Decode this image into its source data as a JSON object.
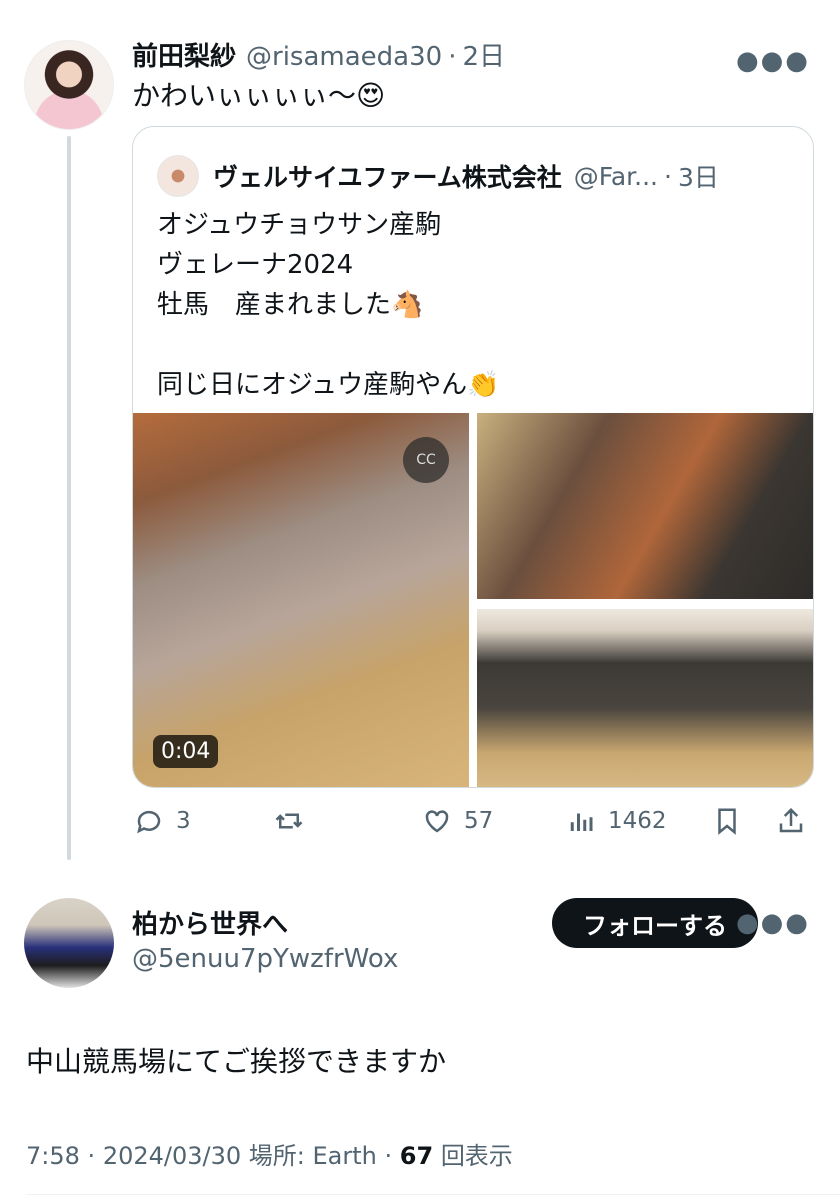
{
  "tweet": {
    "author_name": "前田梨紗",
    "handle": "@risamaeda30",
    "separator": "·",
    "time": "2日",
    "text": "かわいぃぃぃぃ〜😍"
  },
  "quoted": {
    "author_name": "ヴェルサイユファーム株式会社",
    "handle": "@Far...",
    "separator": "·",
    "time": "3日",
    "line1": "オジュウチョウサン産駒",
    "line2": "ヴェレーナ2024",
    "line3": "牡馬　産まれました🐴",
    "line4": "同じ日にオジュウ産駒やん👏",
    "video_duration": "0:04"
  },
  "actions": {
    "reply_count": "3",
    "like_count": "57",
    "views_count": "1462"
  },
  "reply": {
    "author_name": "柏から世界へ",
    "handle": "@5enuu7pYwzfrWox",
    "follow_label": "フォローする",
    "text": "中山競馬場にてご挨拶できますか",
    "time": "7:58",
    "date": "2024/03/30",
    "location": "場所: Earth",
    "views_number": "67",
    "views_label": "回表示"
  },
  "icons": [
    "more-icon",
    "reply-icon",
    "retweet-icon",
    "like-icon",
    "views-icon",
    "bookmark-icon",
    "share-icon",
    "cc-icon"
  ],
  "colors": {
    "text": "#0f1419",
    "muted": "#536471",
    "border": "#cfd9de",
    "button": "#0f1419"
  }
}
